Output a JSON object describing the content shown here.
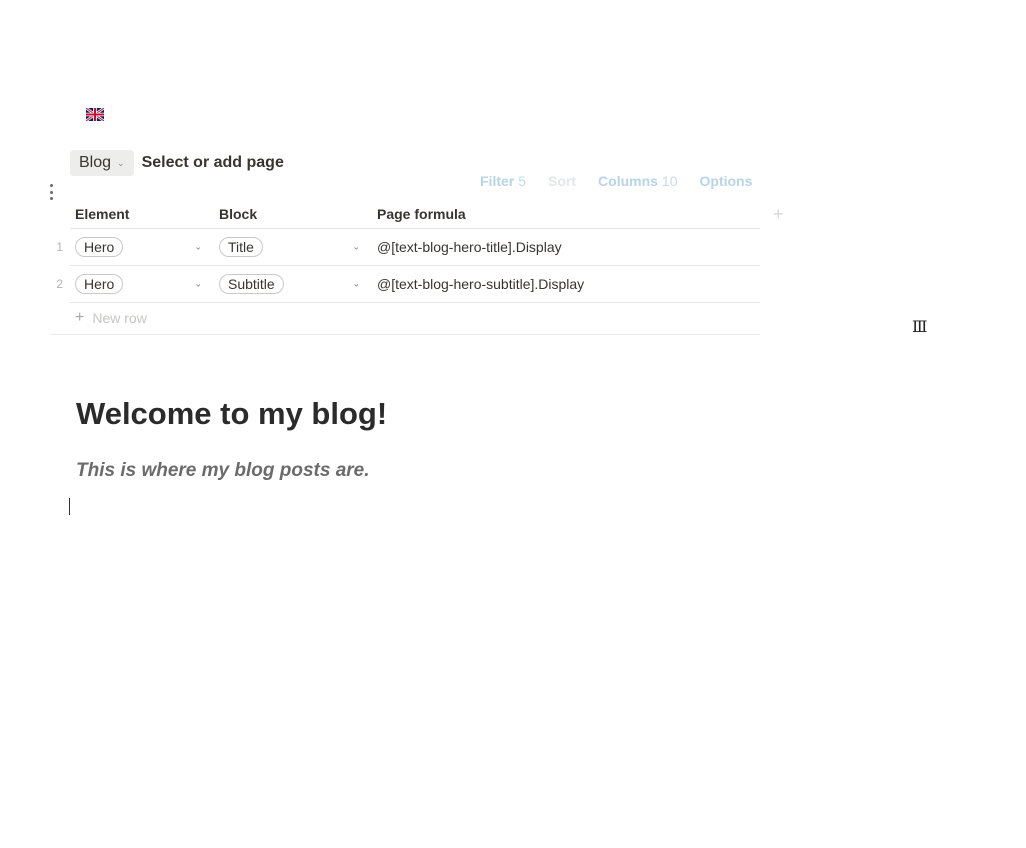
{
  "flag": {
    "icon": "uk-flag-icon"
  },
  "database": {
    "chip_label": "Blog",
    "page_placeholder": "Select or add page"
  },
  "toolbar": {
    "filter_label": "Filter",
    "filter_count": "5",
    "sort_label": "Sort",
    "columns_label": "Columns",
    "columns_count": "10",
    "options_label": "Options"
  },
  "table": {
    "headers": {
      "element": "Element",
      "block": "Block",
      "page_formula": "Page formula"
    },
    "rows": [
      {
        "num": "1",
        "element": "Hero",
        "block": "Title",
        "formula": "@[text-blog-hero-title].Display"
      },
      {
        "num": "2",
        "element": "Hero",
        "block": "Subtitle",
        "formula": "@[text-blog-hero-subtitle].Display"
      }
    ],
    "new_row_label": "New row"
  },
  "content": {
    "heading": "Welcome to my blog!",
    "subtitle": "This is where my blog posts are."
  },
  "colors": {
    "toolbar_text": "#b8d4e8",
    "chip_bg": "#ededec",
    "heading": "#2b2b2b",
    "subtitle": "#6b6b6b"
  }
}
